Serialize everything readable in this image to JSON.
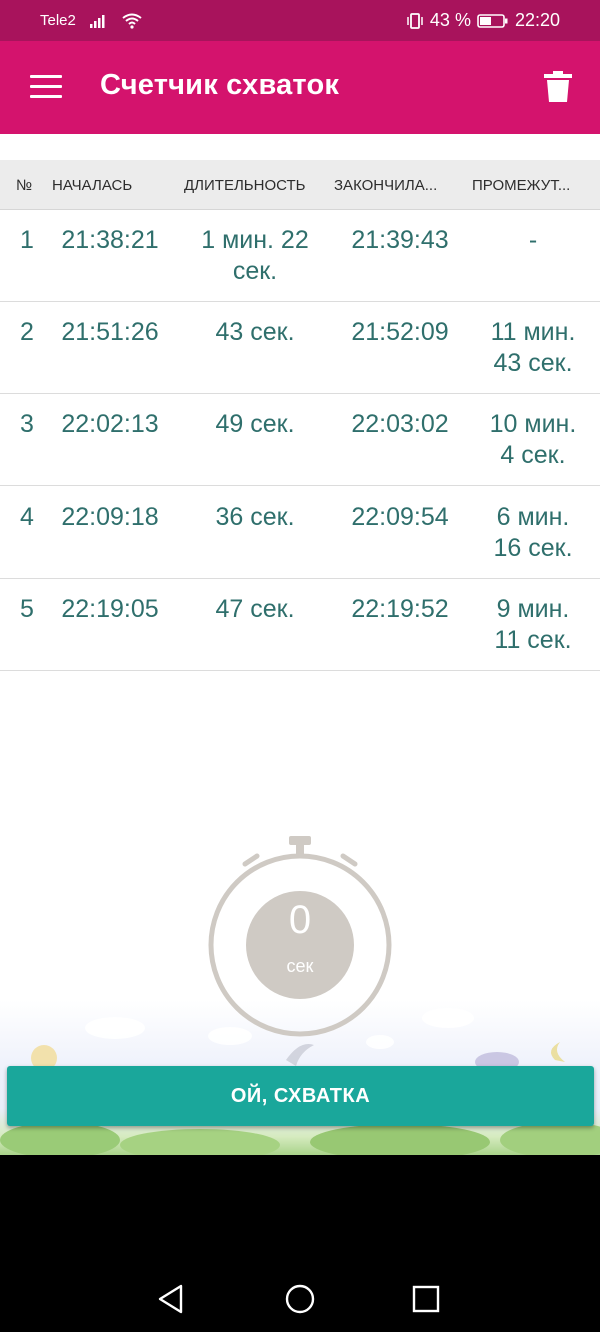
{
  "status_bar": {
    "carrier": "Tele2",
    "battery_percent": "43 %",
    "time": "22:20",
    "icons": [
      "signal-icon",
      "wifi-icon",
      "vibrate-icon",
      "battery-icon"
    ]
  },
  "app_bar": {
    "title": "Счетчик схваток",
    "icons": [
      "menu-icon",
      "trash-icon"
    ]
  },
  "table": {
    "columns": [
      "№",
      "НАЧАЛАСЬ",
      "ДЛИТЕЛЬНОСТЬ",
      "ЗАКОНЧИЛА...",
      "ПРОМЕЖУТ..."
    ],
    "rows": [
      {
        "num": "1",
        "start": "21:38:21",
        "duration_1": "1 мин. 22",
        "duration_2": "сек.",
        "end": "21:39:43",
        "gap_1": "-",
        "gap_2": ""
      },
      {
        "num": "2",
        "start": "21:51:26",
        "duration_1": "43 сек.",
        "duration_2": "",
        "end": "21:52:09",
        "gap_1": "11 мин.",
        "gap_2": "43 сек."
      },
      {
        "num": "3",
        "start": "22:02:13",
        "duration_1": "49 сек.",
        "duration_2": "",
        "end": "22:03:02",
        "gap_1": "10 мин.",
        "gap_2": "4 сек."
      },
      {
        "num": "4",
        "start": "22:09:18",
        "duration_1": "36 сек.",
        "duration_2": "",
        "end": "22:09:54",
        "gap_1": "6 мин.",
        "gap_2": "16 сек."
      },
      {
        "num": "5",
        "start": "22:19:05",
        "duration_1": "47 сек.",
        "duration_2": "",
        "end": "22:19:52",
        "gap_1": "9 мин.",
        "gap_2": "11 сек."
      }
    ]
  },
  "stopwatch": {
    "value": "0",
    "unit": "сек"
  },
  "contraction_button": {
    "label": "ОЙ, СХВАТКА"
  },
  "nav_bar": {
    "icons": [
      "back-icon",
      "home-icon",
      "recents-icon"
    ]
  },
  "colors": {
    "status_bar": "#a8135c",
    "app_bar": "#d4136d",
    "accent": "#1aa79b",
    "table_text": "#2f6f6c",
    "stopwatch": "#cfcac4"
  }
}
